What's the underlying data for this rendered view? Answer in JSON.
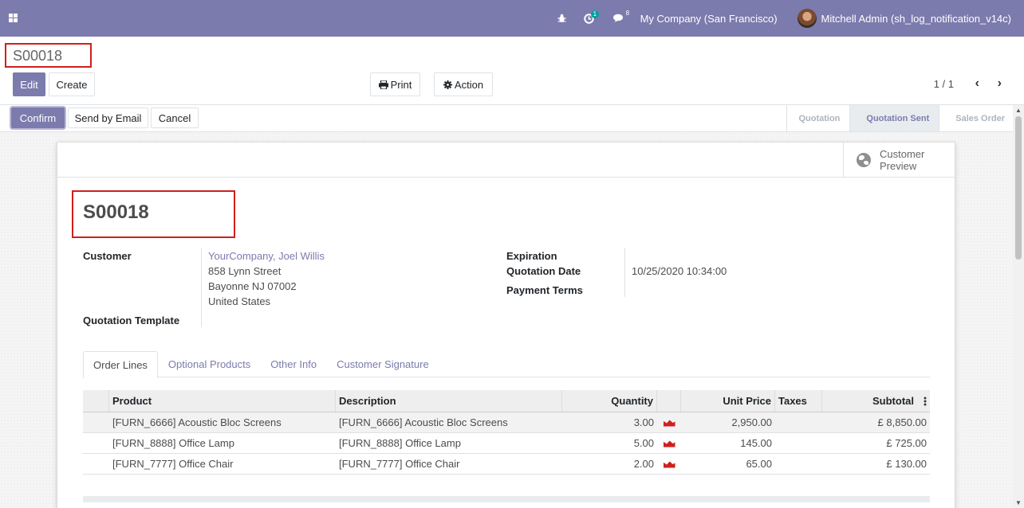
{
  "navbar": {
    "activity_count": "1",
    "message_count": "8",
    "company": "My Company (San Francisco)",
    "user": "Mitchell Admin (sh_log_notification_v14c)"
  },
  "control_panel": {
    "breadcrumb": "S00018",
    "edit_label": "Edit",
    "create_label": "Create",
    "print_label": "Print",
    "action_label": "Action",
    "pager": "1 / 1"
  },
  "statusbar": {
    "confirm_label": "Confirm",
    "send_email_label": "Send by Email",
    "cancel_label": "Cancel",
    "steps": [
      "Quotation",
      "Quotation Sent",
      "Sales Order"
    ]
  },
  "sheet": {
    "smart_button": {
      "line1": "Customer",
      "line2": "Preview"
    },
    "title": "S00018",
    "customer_label": "Customer",
    "customer": {
      "name": "YourCompany, Joel Willis",
      "street": "858 Lynn Street",
      "city": "Bayonne NJ 07002",
      "country": "United States"
    },
    "template_label": "Quotation Template",
    "expiration_label": "Expiration",
    "quotation_date_label": "Quotation Date",
    "quotation_date": "10/25/2020 10:34:00",
    "payment_terms_label": "Payment Terms",
    "tabs": [
      "Order Lines",
      "Optional Products",
      "Other Info",
      "Customer Signature"
    ],
    "columns": {
      "product": "Product",
      "description": "Description",
      "quantity": "Quantity",
      "unit_price": "Unit Price",
      "taxes": "Taxes",
      "subtotal": "Subtotal"
    },
    "lines": [
      {
        "product": "[FURN_6666] Acoustic Bloc Screens",
        "description": "[FURN_6666] Acoustic Bloc Screens",
        "quantity": "3.00",
        "unit_price": "2,950.00",
        "taxes": "",
        "subtotal": "£ 8,850.00"
      },
      {
        "product": "[FURN_8888] Office Lamp",
        "description": "[FURN_8888] Office Lamp",
        "quantity": "5.00",
        "unit_price": "145.00",
        "taxes": "",
        "subtotal": "£ 725.00"
      },
      {
        "product": "[FURN_7777] Office Chair",
        "description": "[FURN_7777] Office Chair",
        "quantity": "2.00",
        "unit_price": "65.00",
        "taxes": "",
        "subtotal": "£ 130.00"
      }
    ]
  },
  "colors": {
    "primary": "#7c7bad",
    "highlight": "#d0201b",
    "badge": "#00a09d"
  }
}
